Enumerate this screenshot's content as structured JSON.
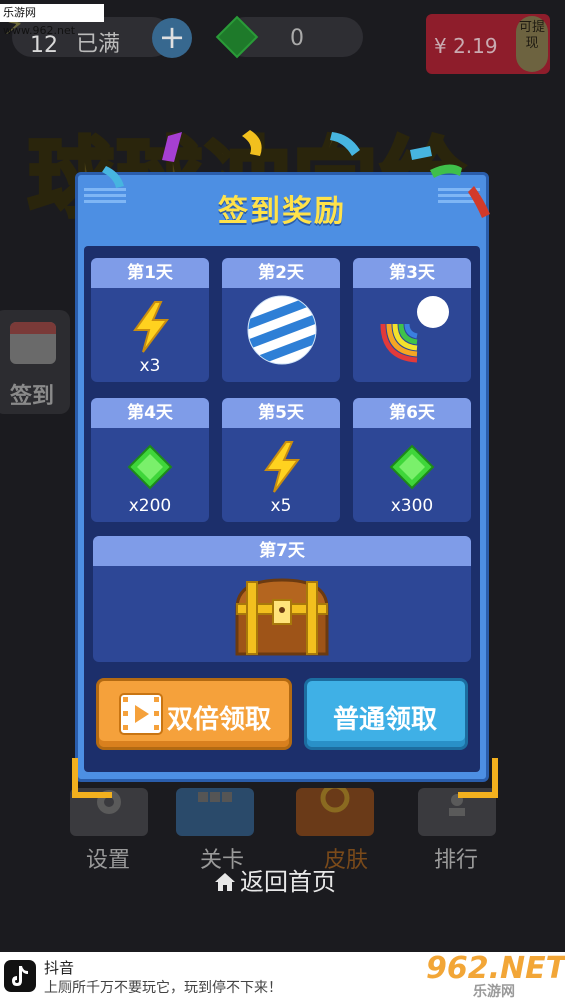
{
  "watermark_top": "乐游网 www.962.net",
  "topbar": {
    "energy_count": "12",
    "energy_status": "已满",
    "add_symbol": "+",
    "gem_count": "0",
    "cash_amount": "¥ 2.19",
    "cash_tag": "可提现"
  },
  "background_title": "球球冲向给",
  "side_button": {
    "label": "签到"
  },
  "modal": {
    "title": "签到奖励",
    "days": [
      {
        "label": "第1天",
        "reward": "lightning-icon",
        "qty": "x3"
      },
      {
        "label": "第2天",
        "reward": "striped-ball-icon",
        "qty": ""
      },
      {
        "label": "第3天",
        "reward": "rainbow-comet-icon",
        "qty": ""
      },
      {
        "label": "第4天",
        "reward": "green-gem-icon",
        "qty": "x200"
      },
      {
        "label": "第5天",
        "reward": "lightning-icon",
        "qty": "x5"
      },
      {
        "label": "第6天",
        "reward": "green-gem-icon",
        "qty": "x300"
      }
    ],
    "day7": {
      "label": "第7天",
      "reward": "treasure-chest-icon"
    },
    "double_button": "双倍领取",
    "normal_button": "普通领取"
  },
  "bottom_menu": [
    {
      "label": "设置",
      "icon": "gear-icon"
    },
    {
      "label": "关卡",
      "icon": "levels-icon"
    },
    {
      "label": "皮肤",
      "icon": "skin-icon"
    },
    {
      "label": "排行",
      "icon": "ranking-icon"
    }
  ],
  "home_link": "返回首页",
  "ad": {
    "app_name": "抖音",
    "slogan": "上厕所千万不要玩它，玩到停不下来！",
    "watermark_brand": "962.NET",
    "watermark_sub": "乐游网"
  },
  "colors": {
    "modal_blue": "#4d8fe3",
    "title_yellow": "#ffe24a",
    "double_orange": "#f5a13b",
    "normal_blue": "#3fb0e6",
    "gem_green": "#3fd63a",
    "bolt_yellow": "#ffd21f"
  }
}
